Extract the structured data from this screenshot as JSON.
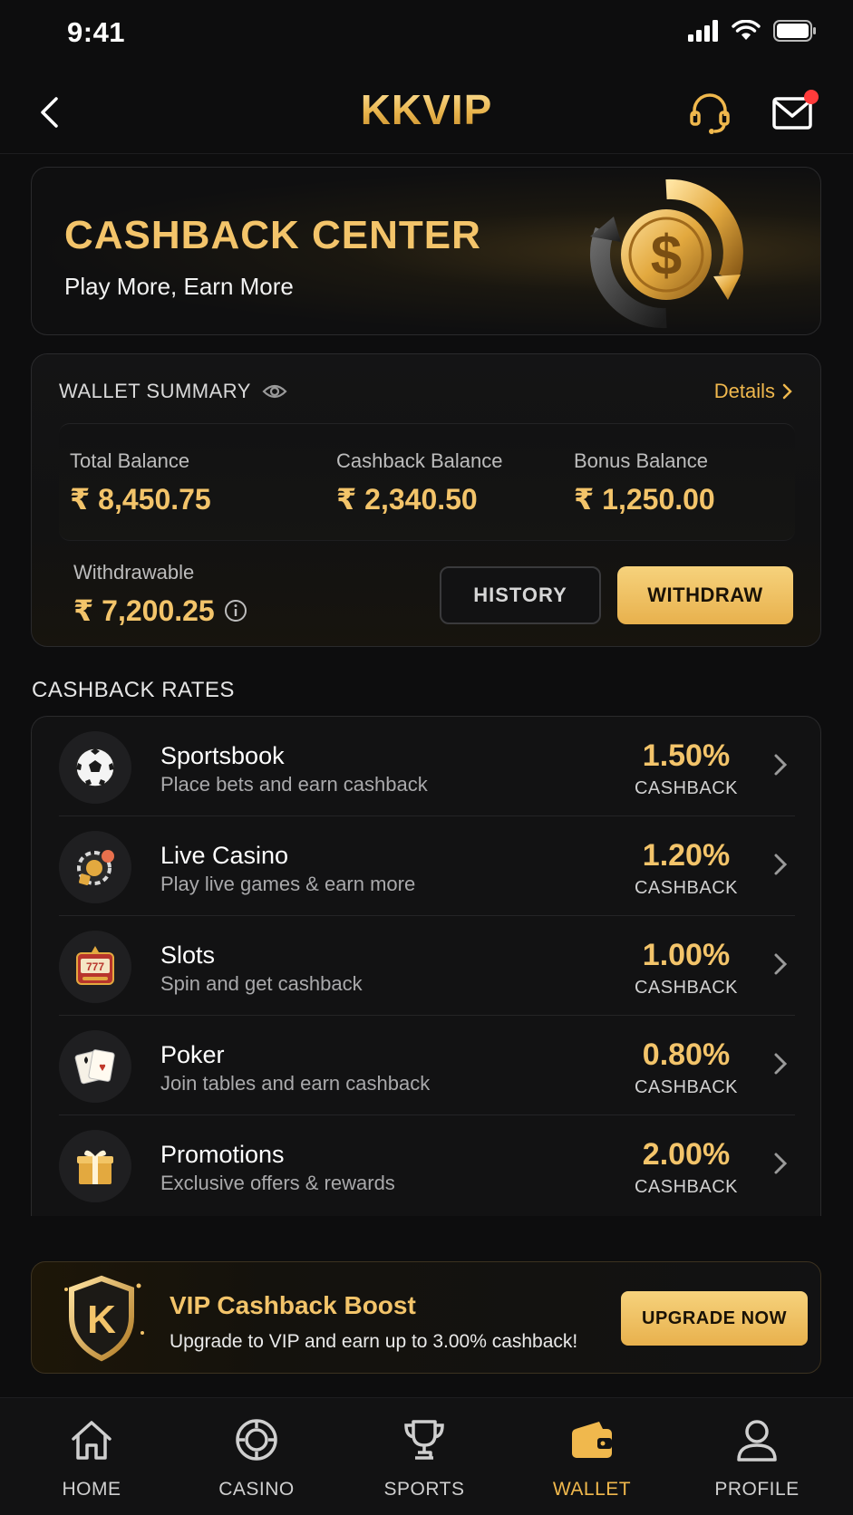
{
  "status_bar": {
    "time": "9:41"
  },
  "header": {
    "brand": "KKVIP"
  },
  "hero": {
    "title": "CASHBACK CENTER",
    "subtitle": "Play More, Earn More"
  },
  "wallet": {
    "title": "WALLET SUMMARY",
    "details_label": "Details",
    "balances": [
      {
        "label": "Total Balance",
        "value": "₹ 8,450.75"
      },
      {
        "label": "Cashback Balance",
        "value": "₹ 2,340.50"
      },
      {
        "label": "Bonus Balance",
        "value": "₹ 1,250.00"
      }
    ],
    "withdrawable": {
      "label": "Withdrawable",
      "value": "₹ 7,200.25"
    },
    "history_label": "HISTORY",
    "withdraw_label": "WITHDRAW"
  },
  "rates": {
    "title": "CASHBACK RATES",
    "items": [
      {
        "name": "Sportsbook",
        "desc": "Place bets and earn cashback",
        "pct": "1.50%",
        "unit": "CASHBACK",
        "icon": "soccer-ball-icon"
      },
      {
        "name": "Live Casino",
        "desc": "Play live games & earn more",
        "pct": "1.20%",
        "unit": "CASHBACK",
        "icon": "casino-chips-icon"
      },
      {
        "name": "Slots",
        "desc": "Spin and get cashback",
        "pct": "1.00%",
        "unit": "CASHBACK",
        "icon": "slot-machine-icon"
      },
      {
        "name": "Poker",
        "desc": "Join tables and earn cashback",
        "pct": "0.80%",
        "unit": "CASHBACK",
        "icon": "playing-cards-icon"
      },
      {
        "name": "Promotions",
        "desc": "Exclusive offers & rewards",
        "pct": "2.00%",
        "unit": "CASHBACK",
        "icon": "gift-icon"
      }
    ]
  },
  "vip": {
    "badge_letter": "K",
    "title": "VIP Cashback Boost",
    "subtitle": "Upgrade to VIP and earn up to 3.00% cashback!",
    "button_label": "UPGRADE NOW"
  },
  "tabbar": {
    "tabs": [
      {
        "label": "HOME",
        "active": false
      },
      {
        "label": "CASINO",
        "active": false
      },
      {
        "label": "SPORTS",
        "active": false
      },
      {
        "label": "WALLET",
        "active": true
      },
      {
        "label": "PROFILE",
        "active": false
      }
    ]
  },
  "colors": {
    "accent": "#f3c46a",
    "background": "#0d0d0e",
    "notification": "#ff3b3b"
  }
}
